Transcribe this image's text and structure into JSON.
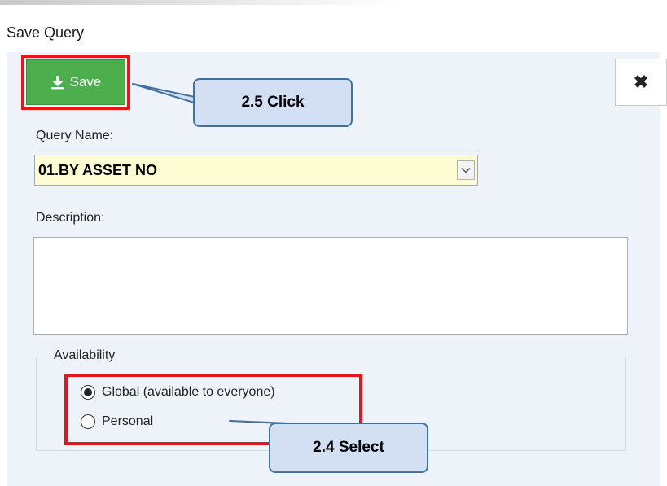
{
  "dialog": {
    "title": "Save Query"
  },
  "toolbar": {
    "save_label": "Save",
    "save_icon": "download-icon",
    "close_icon": "close-icon"
  },
  "form": {
    "query_name_label": "Query Name:",
    "query_name_value": "01.BY ASSET NO",
    "description_label": "Description:",
    "description_value": "",
    "availability_label": "Availability",
    "options": [
      {
        "label": "Global (available to everyone)",
        "selected": true
      },
      {
        "label": "Personal",
        "selected": false
      }
    ]
  },
  "annotations": {
    "click_label": "2.5 Click",
    "select_label": "2.4 Select"
  },
  "colors": {
    "save_button": "#4cae4c",
    "highlight_border": "#e8141b",
    "callout_fill": "#d3e0f3",
    "callout_border": "#41719c",
    "query_field_background": "#fdfcd2",
    "dialog_background": "#eef3fa"
  }
}
